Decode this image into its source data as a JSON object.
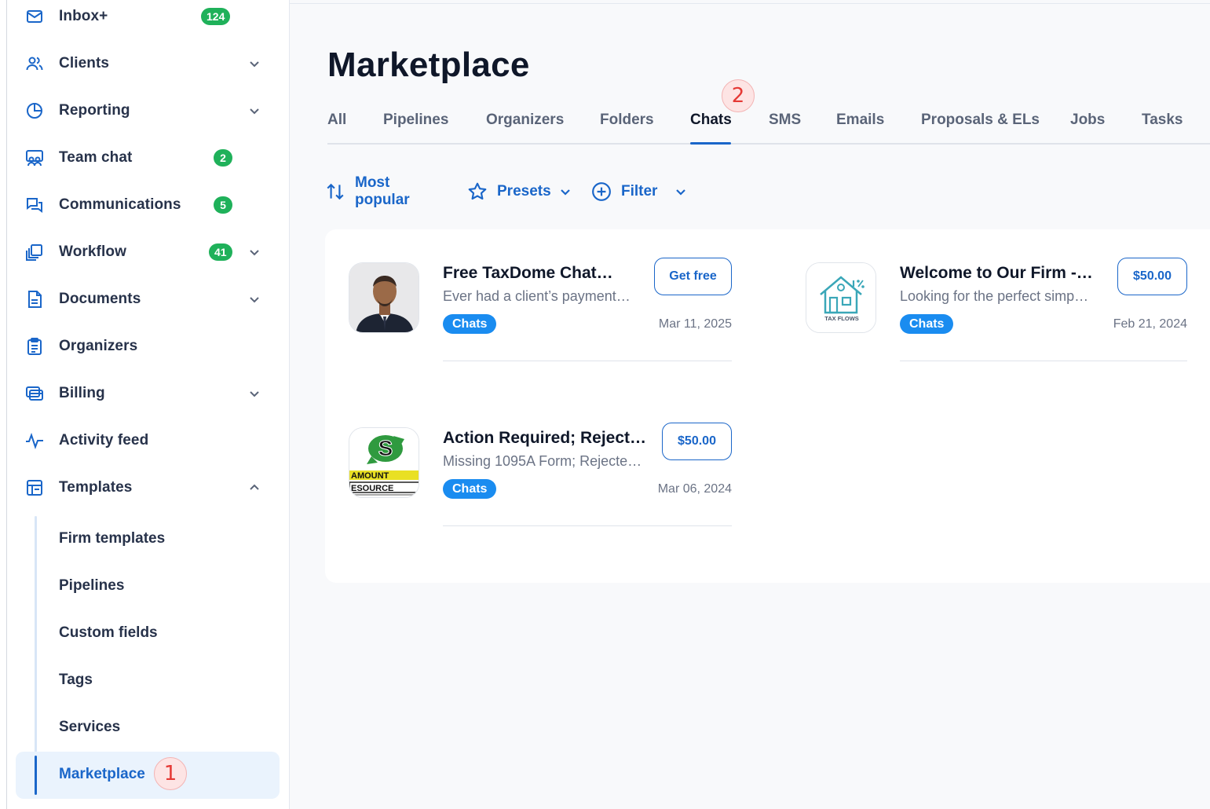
{
  "sidebar": {
    "items": [
      {
        "label": "Inbox+",
        "icon": "mail-icon",
        "badge": "124",
        "chevron": false
      },
      {
        "label": "Clients",
        "icon": "users-icon",
        "badge": null,
        "chevron": true
      },
      {
        "label": "Reporting",
        "icon": "pie-chart-icon",
        "badge": null,
        "chevron": true
      },
      {
        "label": "Team chat",
        "icon": "team-chat-icon",
        "badge": "2",
        "chevron": false
      },
      {
        "label": "Communications",
        "icon": "chat-bubbles-icon",
        "badge": "5",
        "chevron": false
      },
      {
        "label": "Workflow",
        "icon": "workflow-icon",
        "badge": "41",
        "chevron": true
      },
      {
        "label": "Documents",
        "icon": "document-icon",
        "badge": null,
        "chevron": true
      },
      {
        "label": "Organizers",
        "icon": "clipboard-icon",
        "badge": null,
        "chevron": false
      },
      {
        "label": "Billing",
        "icon": "billing-icon",
        "badge": null,
        "chevron": true
      },
      {
        "label": "Activity feed",
        "icon": "activity-icon",
        "badge": null,
        "chevron": false
      },
      {
        "label": "Templates",
        "icon": "templates-icon",
        "badge": null,
        "chevron": "up"
      }
    ],
    "sub_items": [
      {
        "label": "Firm templates"
      },
      {
        "label": "Pipelines"
      },
      {
        "label": "Custom fields"
      },
      {
        "label": "Tags"
      },
      {
        "label": "Services"
      },
      {
        "label": "Marketplace",
        "active": true
      }
    ],
    "marker": "1"
  },
  "main": {
    "title": "Marketplace",
    "tabs": [
      {
        "label": "All"
      },
      {
        "label": "Pipelines"
      },
      {
        "label": "Organizers"
      },
      {
        "label": "Folders"
      },
      {
        "label": "Chats",
        "active": true
      },
      {
        "label": "SMS"
      },
      {
        "label": "Emails"
      },
      {
        "label": "Proposals & ELs"
      },
      {
        "label": "Jobs"
      },
      {
        "label": "Tasks"
      }
    ],
    "tab_marker": "2",
    "toolbar": {
      "sort_label": "Most popular",
      "presets_label": "Presets",
      "filter_label": "Filter"
    },
    "cards": [
      {
        "title": "Free TaxDome Chat…",
        "desc": "Ever had a client’s payment…",
        "price": "Get free",
        "tag": "Chats",
        "date": "Mar 11, 2025",
        "thumb": "person-photo"
      },
      {
        "title": "Welcome to Our Firm -…",
        "desc": "Looking for the perfect simp…",
        "price": "$50.00",
        "tag": "Chats",
        "date": "Feb 21, 2024",
        "thumb": "tax-flows-logo",
        "thumb_text": "TAX FLOWS"
      },
      {
        "title": "Action Required; Reject…",
        "desc": "Missing 1095A Form; Rejecte…",
        "price": "$50.00",
        "tag": "Chats",
        "date": "Mar 06, 2024",
        "thumb": "paramount-resources-logo",
        "thumb_text_top": "AMOUNT",
        "thumb_text_bottom": "ESOURCE"
      }
    ]
  },
  "colors": {
    "accent": "#1a66c9",
    "badge_green": "#1fb15a",
    "chip_blue": "#1a8cf0",
    "marker_red": "#e53935"
  }
}
